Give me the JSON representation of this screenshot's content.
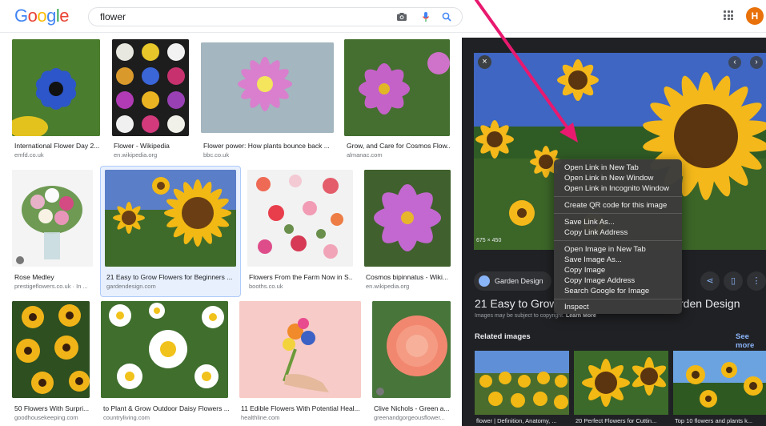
{
  "header": {
    "logo": "Google",
    "query": "flower",
    "avatar_letter": "H",
    "icons": [
      "camera-icon",
      "mic-icon",
      "search-icon",
      "apps-icon"
    ]
  },
  "results": [
    {
      "caption": "International Flower Day 2...",
      "source": "emfd.co.uk"
    },
    {
      "caption": "Flower - Wikipedia",
      "source": "en.wikipedia.org"
    },
    {
      "caption": "Flower power: How plants bounce back ...",
      "source": "bbc.co.uk"
    },
    {
      "caption": "Grow, and Care for Cosmos Flow...",
      "source": "almanac.com"
    },
    {
      "caption": "Rose Medley",
      "source": "prestigeflowers.co.uk · In ..."
    },
    {
      "caption": "21 Easy to Grow Flowers for Beginners ...",
      "source": "gardendesign.com"
    },
    {
      "caption": "Flowers From the Farm Now in S...",
      "source": "booths.co.uk"
    },
    {
      "caption": "Cosmos bipinnatus - Wiki...",
      "source": "en.wikipedia.org"
    },
    {
      "caption": "50 Flowers With Surpri...",
      "source": "goodhousekeeping.com"
    },
    {
      "caption": "to Plant & Grow Outdoor Daisy Flowers ...",
      "source": "countryliving.com"
    },
    {
      "caption": "11 Edible Flowers With Potential Heal...",
      "source": "healthline.com"
    },
    {
      "caption": "Clive Nichols - Green a...",
      "source": "greenandgorgeousflower..."
    }
  ],
  "panel": {
    "dimensions": "675 × 450",
    "site": "Garden Design",
    "title_left": "21 Easy to Grow",
    "title_right": "rden Design",
    "copyright": "Images may be subject to copyright.",
    "learn_more": "Learn More",
    "related_label": "Related images",
    "see_more": "See more",
    "related": [
      {
        "caption": "flower | Definition, Anatomy, ..."
      },
      {
        "caption": "20 Perfect Flowers for Cuttin..."
      },
      {
        "caption": "Top 10 flowers and plants k..."
      }
    ]
  },
  "context_menu": {
    "group1": [
      "Open Link in New Tab",
      "Open Link in New Window",
      "Open Link in Incognito Window"
    ],
    "group2": [
      "Create QR code for this image"
    ],
    "group3": [
      "Save Link As...",
      "Copy Link Address"
    ],
    "group4": [
      "Open Image in New Tab",
      "Save Image As...",
      "Copy Image",
      "Copy Image Address",
      "Search Google for Image"
    ],
    "group5": [
      "Inspect"
    ]
  },
  "colors": {
    "accent": "#e8196f",
    "panel_bg": "#202124",
    "link": "#8ab4f8"
  }
}
